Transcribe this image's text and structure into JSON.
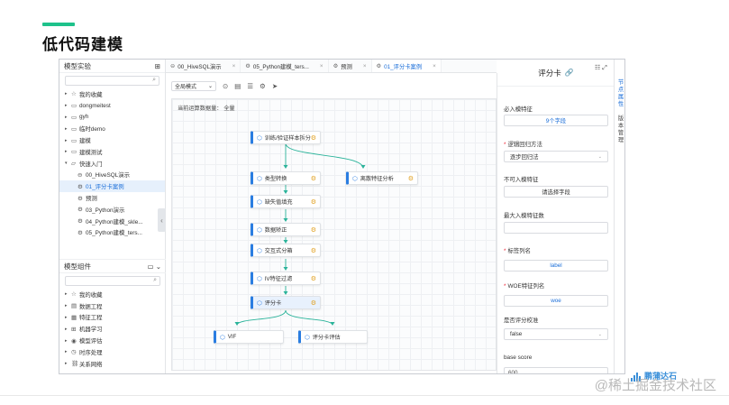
{
  "slide": {
    "title": "低代码建模",
    "watermark": "@稀土掘金技术社区",
    "logo_text": "鹏蒲达石",
    "accent_color": "#1ec28b"
  },
  "left_panel": {
    "title": "模型实验",
    "tree": [
      {
        "label": "我的收藏",
        "icon": "star-icon",
        "arrow": "▸",
        "child": false
      },
      {
        "label": "dongmeitest",
        "icon": "folder-icon",
        "arrow": "▸",
        "child": false
      },
      {
        "label": "gyh",
        "icon": "folder-icon",
        "arrow": "▸",
        "child": false
      },
      {
        "label": "临时demo",
        "icon": "folder-icon",
        "arrow": "▸",
        "child": false
      },
      {
        "label": "建模",
        "icon": "folder-icon",
        "arrow": "▸",
        "child": false
      },
      {
        "label": "建模测试",
        "icon": "folder-icon",
        "arrow": "▸",
        "child": false
      },
      {
        "label": "快速入门",
        "icon": "folder-open-icon",
        "arrow": "▾",
        "child": false
      },
      {
        "label": "00_HiveSQL演示",
        "icon": "sql-icon",
        "arrow": "",
        "child": true
      },
      {
        "label": "01_评分卡案例",
        "icon": "gear-icon",
        "arrow": "",
        "child": true,
        "selected": true
      },
      {
        "label": "预测",
        "icon": "gear-icon",
        "arrow": "",
        "child": true
      },
      {
        "label": "03_Python演示",
        "icon": "gear-icon",
        "arrow": "",
        "child": true
      },
      {
        "label": "04_Python建模_skle...",
        "icon": "gear-icon",
        "arrow": "",
        "child": true
      },
      {
        "label": "05_Python建模_ters...",
        "icon": "gear-icon",
        "arrow": "",
        "child": true
      }
    ],
    "components_title": "模型组件",
    "components": [
      {
        "label": "我的收藏",
        "icon": "star-icon"
      },
      {
        "label": "数据工程",
        "icon": "database-icon"
      },
      {
        "label": "特征工程",
        "icon": "feature-icon"
      },
      {
        "label": "机器学习",
        "icon": "ml-icon"
      },
      {
        "label": "模型评估",
        "icon": "eval-icon"
      },
      {
        "label": "时序处理",
        "icon": "clock-icon"
      },
      {
        "label": "关系网络",
        "icon": "network-icon"
      }
    ]
  },
  "tabs": [
    {
      "label": "00_HiveSQL演示",
      "active": false
    },
    {
      "label": "05_Python建模_ters...",
      "active": false
    },
    {
      "label": "预测",
      "active": false
    },
    {
      "label": "01_评分卡案例",
      "active": true
    }
  ],
  "toolbar": {
    "mode": "全局模式"
  },
  "canvas": {
    "info": "当前运算数据量： 全量",
    "nodes": [
      {
        "label": "训练/验证样本拆分",
        "gear": true
      },
      {
        "label": "类型转换",
        "gear": true
      },
      {
        "label": "离散特征分析",
        "gear": true
      },
      {
        "label": "缺失值填充",
        "gear": true
      },
      {
        "label": "数据矫正",
        "gear": true
      },
      {
        "label": "交互式分箱",
        "gear": true
      },
      {
        "label": "IV特征过滤",
        "gear": true
      },
      {
        "label": "评分卡",
        "gear": true,
        "selected": true
      },
      {
        "label": "VIF",
        "gear": false
      },
      {
        "label": "评分卡评估",
        "gear": false
      }
    ]
  },
  "right_panel": {
    "title": "评分卡",
    "fields": [
      {
        "label": "必入模特征",
        "required": false,
        "kind": "button",
        "value": "9个字段"
      },
      {
        "label": "逻辑回归方法",
        "required": true,
        "kind": "select",
        "value": "逐步回归法"
      },
      {
        "label": "不可入模特征",
        "required": false,
        "kind": "button-plain",
        "value": "请选择字段"
      },
      {
        "label": "最大入模特征数",
        "required": false,
        "kind": "input",
        "value": ""
      },
      {
        "label": "标签列名",
        "required": true,
        "kind": "button",
        "value": "label"
      },
      {
        "label": "WOE特征列名",
        "required": true,
        "kind": "button",
        "value": "woe"
      },
      {
        "label": "是否评分校准",
        "required": false,
        "kind": "select",
        "value": "false"
      },
      {
        "label": "base score",
        "required": false,
        "kind": "input-partial",
        "value": "600"
      }
    ],
    "side_tabs": [
      {
        "label": "节点属性",
        "active": true
      },
      {
        "label": "版本管理",
        "active": false
      }
    ]
  }
}
